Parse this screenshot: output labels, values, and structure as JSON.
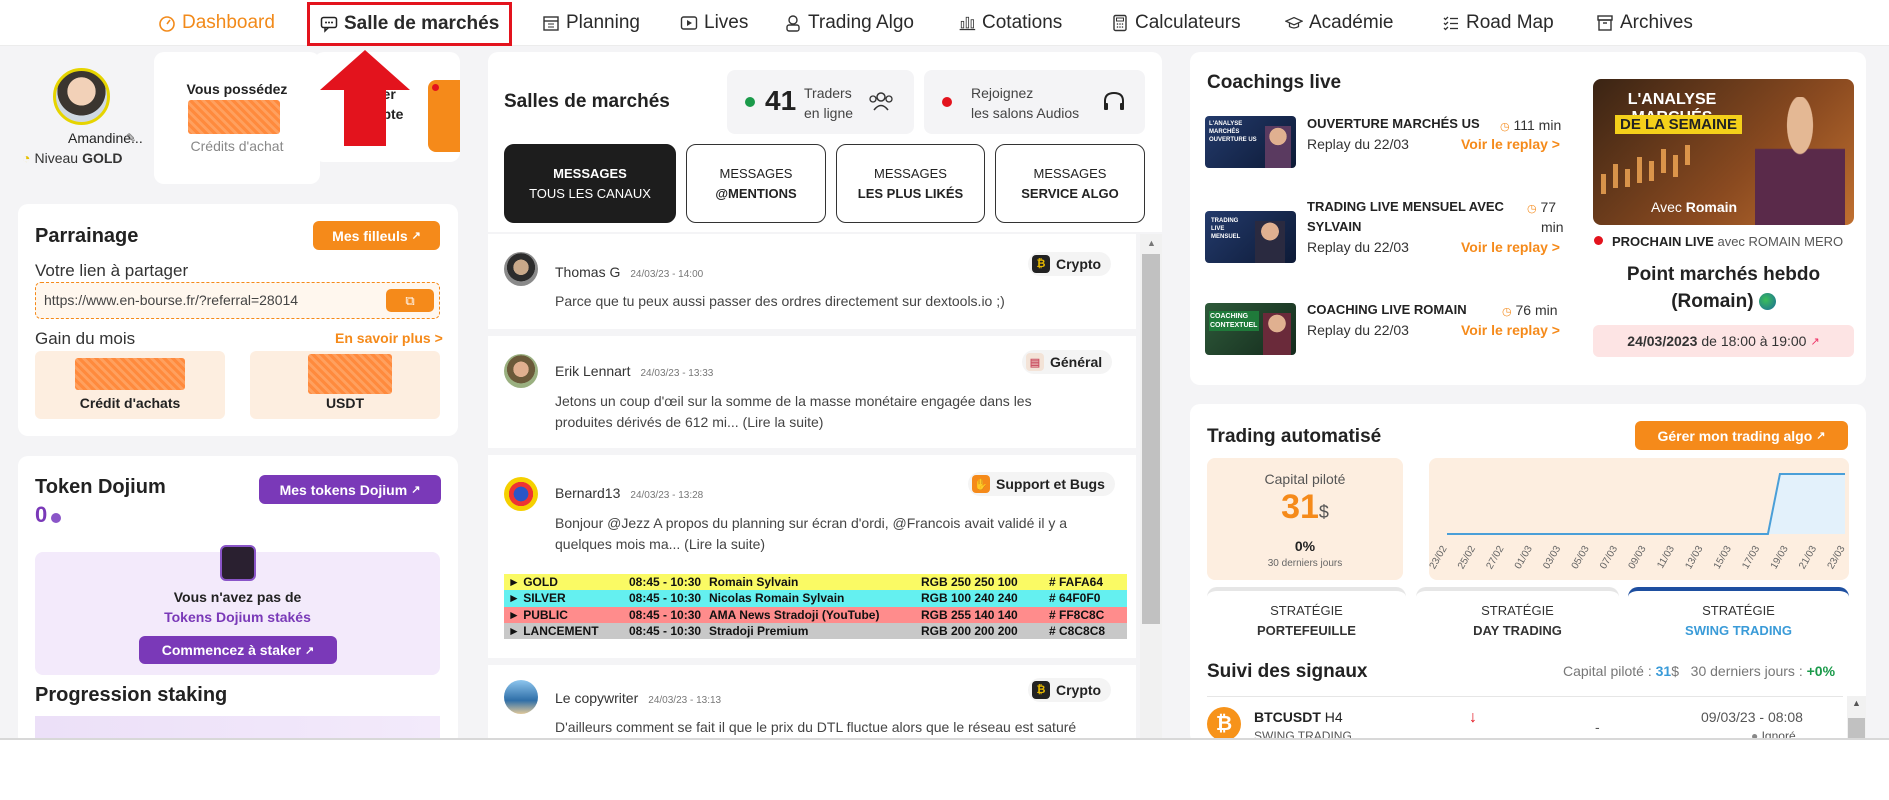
{
  "nav": {
    "items": [
      {
        "label": "Dashboard",
        "icon": "gauge-icon"
      },
      {
        "label": "Salle de marchés",
        "icon": "chat-icon"
      },
      {
        "label": "Planning",
        "icon": "calendar-icon"
      },
      {
        "label": "Lives",
        "icon": "play-icon"
      },
      {
        "label": "Trading Algo",
        "icon": "robot-icon"
      },
      {
        "label": "Cotations",
        "icon": "chart-icon"
      },
      {
        "label": "Calculateurs",
        "icon": "calculator-icon"
      },
      {
        "label": "Académie",
        "icon": "graduation-icon"
      },
      {
        "label": "Road Map",
        "icon": "checklist-icon"
      },
      {
        "label": "Archives",
        "icon": "archive-icon"
      }
    ]
  },
  "profile": {
    "name": "Amandine...",
    "level_prefix": "Niveau",
    "level": "GOLD",
    "possess_title": "Vous possédez",
    "credits_label": "Crédits d'achat",
    "recharge_partial": "ger",
    "recharge_partial2": "mpte"
  },
  "parrainage": {
    "title": "Parrainage",
    "button": "Mes filleuls",
    "share_label": "Votre lien à partager",
    "link": "https://www.en-bourse.fr/?referral=28014",
    "gain_label": "Gain du mois",
    "more_link": "En savoir plus >",
    "box1_label": "Crédit d'achats",
    "box2_label": "USDT"
  },
  "token": {
    "title": "Token Dojium",
    "button": "Mes tokens Dojium",
    "amount": "0",
    "empty_line1": "Vous n'avez pas de",
    "empty_line2": "Tokens Dojium stakés",
    "stake_button": "Commencez à staker",
    "progression_title": "Progression staking"
  },
  "salles": {
    "title": "Salles de marchés",
    "traders_count": "41",
    "traders_label1": "Traders",
    "traders_label2": "en ligne",
    "audio_label1": "Rejoignez",
    "audio_label2": "les salons Audios",
    "tabs": [
      {
        "line1": "MESSAGES",
        "line2": "TOUS LES CANAUX"
      },
      {
        "line1": "MESSAGES",
        "line2": "@MENTIONS"
      },
      {
        "line1": "MESSAGES",
        "line2": "LES PLUS LIKÉS"
      },
      {
        "line1": "MESSAGES",
        "line2": "SERVICE ALGO"
      }
    ]
  },
  "messages": [
    {
      "author": "Thomas G",
      "date": "24/03/23 - 14:00",
      "channel": "Crypto",
      "text1": "Parce que tu peux aussi passer des ordres directement sur dextools.io ;)",
      "text2": ""
    },
    {
      "author": "Erik Lennart",
      "date": "24/03/23 - 13:33",
      "channel": "Général",
      "text1": "Jetons un coup d'œil sur la somme de la masse monétaire engagée dans les",
      "text2": "produites dérivés de 612 mi... (Lire la suite)"
    },
    {
      "author": "Bernard13",
      "date": "24/03/23 - 13:28",
      "channel": "Support et Bugs",
      "text1": "Bonjour @Jezz A propos du planning sur écran d'ordi, @Francois avait validé il y a",
      "text2": "quelques mois ma... (Lire la suite)"
    },
    {
      "author": "Le copywriter",
      "date": "24/03/23 - 13:13",
      "channel": "Crypto",
      "text1": "D'ailleurs comment se fait il que le prix du DTL fluctue alors que le réseau est saturé",
      "text2": ""
    }
  ],
  "planning_table": [
    {
      "name": "► GOLD",
      "time": "08:45 - 10:30",
      "who": "Romain Sylvain",
      "rgb": "RGB 250 250 100",
      "hex": "# FAFA64",
      "color": "#fafa64"
    },
    {
      "name": "► SILVER",
      "time": "08:45 - 10:30",
      "who": "Nicolas Romain Sylvain",
      "rgb": "RGB 100 240 240",
      "hex": "# 64F0F0",
      "color": "#64f0f0"
    },
    {
      "name": "► PUBLIC",
      "time": "08:45 - 10:30",
      "who": "AMA News Stradoji (YouTube)",
      "rgb": "RGB 255 140 140",
      "hex": "# FF8C8C",
      "color": "#ff8c8c"
    },
    {
      "name": "► LANCEMENT",
      "time": "08:45 - 10:30",
      "who": "Stradoji Premium",
      "rgb": "RGB 200 200 200",
      "hex": "# C8C8C8",
      "color": "#c8c8c8"
    }
  ],
  "coachings": {
    "title": "Coachings live",
    "items": [
      {
        "title1": "OUVERTURE MARCHÉS US",
        "title2": "",
        "duration": "111 min",
        "duration2": "",
        "replay": "Replay du 22/03",
        "link": "Voir le replay >",
        "thumb": "L'ANALYSE MARCHÉS OUVERTURE US"
      },
      {
        "title1": "TRADING LIVE MENSUEL AVEC",
        "title2": "SYLVAIN",
        "duration": "77",
        "duration2": "min",
        "replay": "Replay du 22/03",
        "link": "Voir le replay >",
        "thumb": "TRADING LIVE MENSUEL"
      },
      {
        "title1": "COACHING LIVE ROMAIN",
        "title2": "",
        "duration": "76 min",
        "duration2": "",
        "replay": "Replay du 22/03",
        "link": "Voir le replay >",
        "thumb": "COACHING CONTEXTUEL"
      }
    ],
    "feature": {
      "img_line1": "L'ANALYSE MARCHÉS",
      "img_line2": "DE LA SEMAINE",
      "img_with": "Avec",
      "img_name": "Romain",
      "next_label": "PROCHAIN LIVE",
      "next_with": "avec ROMAIN MERO",
      "title1": "Point marchés hebdo",
      "title2": "(Romain)",
      "date_bold": "24/03/2023",
      "date_rest": "de 18:00 à 19:00"
    }
  },
  "trading": {
    "title": "Trading automatisé",
    "button": "Gérer mon trading algo",
    "capital_label": "Capital piloté",
    "capital_value": "31",
    "capital_unit": "$",
    "pct": "0%",
    "period": "30 derniers jours",
    "strategies": [
      {
        "line1": "STRATÉGIE",
        "line2": "PORTEFEUILLE"
      },
      {
        "line1": "STRATÉGIE",
        "line2": "DAY TRADING"
      },
      {
        "line1": "STRATÉGIE",
        "line2": "SWING TRADING"
      }
    ],
    "signals_title": "Suivi des signaux",
    "signals_capital_label": "Capital piloté :",
    "signals_capital_value": "31",
    "signals_capital_unit": "$",
    "signals_period_label": "30 derniers jours :",
    "signals_period_value": "+0%",
    "signal": {
      "pair": "BTCUSDT",
      "tf": "H4",
      "strategy": "SWING TRADING",
      "date": "09/03/23 - 08:08",
      "status": "Ignoré",
      "dash": "-"
    }
  },
  "chart_data": {
    "type": "line",
    "x": [
      "23/02",
      "25/02",
      "27/02",
      "01/03",
      "03/03",
      "05/03",
      "07/03",
      "09/03",
      "11/03",
      "13/03",
      "15/03",
      "17/03",
      "19/03",
      "21/03",
      "23/03"
    ],
    "values": [
      0,
      0,
      0,
      0,
      0,
      0,
      0,
      0,
      0,
      0,
      0,
      0,
      1,
      1,
      1
    ],
    "title": "",
    "xlabel": "",
    "ylabel": "",
    "colors": {
      "line": "#4a9fd8",
      "fill": "#e3f1fb"
    }
  },
  "colors": {
    "accent": "#f58a1a",
    "purple": "#7a39b8",
    "highlight": "#e3131d"
  }
}
